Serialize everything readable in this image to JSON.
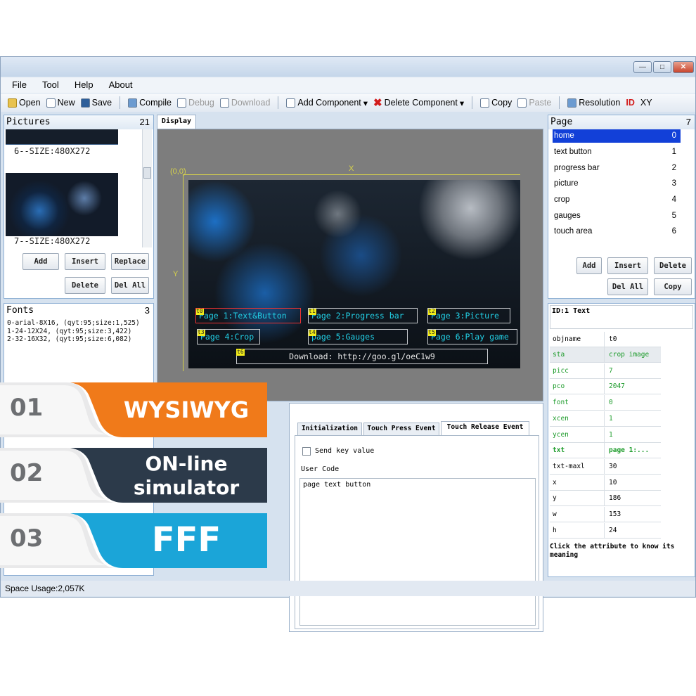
{
  "window": {
    "min_glyph": "—",
    "max_glyph": "□",
    "close_glyph": "✕"
  },
  "menu": [
    "File",
    "Tool",
    "Help",
    "About"
  ],
  "toolbar": {
    "open": "Open",
    "new": "New",
    "save": "Save",
    "compile": "Compile",
    "debug": "Debug",
    "download": "Download",
    "add_component": "Add Component",
    "delete_component": "Delete Component",
    "copy": "Copy",
    "paste": "Paste",
    "resolution": "Resolution",
    "id": "ID",
    "xy": "XY",
    "dropdown": "▾"
  },
  "pictures": {
    "title": "Pictures",
    "count": "21",
    "cap6": "6--SIZE:480X272",
    "cap7": "7--SIZE:480X272",
    "add": "Add",
    "insert": "Insert",
    "replace": "Replace",
    "delete": "Delete",
    "del_all": "Del All"
  },
  "fonts": {
    "title": "Fonts",
    "count": "3",
    "items": [
      "0-arial-8X16, (qyt:95;size:1,525)",
      "1-24-12X24, (qyt:95;size:3,422)",
      "2-32-16X32, (qyt:95;size:6,082)"
    ]
  },
  "display": {
    "tab": "Display",
    "origin": "(0,0)",
    "x_label": "X",
    "y_label": "Y",
    "buttons": [
      {
        "tag": "t0",
        "text": "Page 1:Text&Button"
      },
      {
        "tag": "t1",
        "text": "Page 2:Progress bar"
      },
      {
        "tag": "t2",
        "text": "Page 3:Picture"
      },
      {
        "tag": "t3",
        "text": "Page 4:Crop"
      },
      {
        "tag": "t4",
        "text": "page 5:Gauges"
      },
      {
        "tag": "t5",
        "text": "Page 6:Play game"
      }
    ],
    "download_tag": "t6",
    "download_text": "Download: http://goo.gl/oeC1w9"
  },
  "events": {
    "tabs": [
      "Initialization",
      "Touch Press Event",
      "Touch Release Event"
    ],
    "send_key": "Send key value",
    "user_code_label": "User Code",
    "code": "page text button"
  },
  "page": {
    "title": "Page",
    "count": "7",
    "items": [
      {
        "name": "home",
        "n": "0"
      },
      {
        "name": "text button",
        "n": "1"
      },
      {
        "name": "progress bar",
        "n": "2"
      },
      {
        "name": "picture",
        "n": "3"
      },
      {
        "name": "crop",
        "n": "4"
      },
      {
        "name": "gauges",
        "n": "5"
      },
      {
        "name": "touch area",
        "n": "6"
      }
    ],
    "add": "Add",
    "insert": "Insert",
    "delete": "Delete",
    "del_all": "Del All",
    "copy": "Copy"
  },
  "attrs": {
    "header": "ID:1 Text",
    "rows": [
      {
        "k": "objname",
        "v": "t0"
      },
      {
        "k": "sta",
        "v": "crop image"
      },
      {
        "k": "picc",
        "v": "7"
      },
      {
        "k": "pco",
        "v": "2047"
      },
      {
        "k": "font",
        "v": "0"
      },
      {
        "k": "xcen",
        "v": "1"
      },
      {
        "k": "ycen",
        "v": "1"
      },
      {
        "k": "txt",
        "v": "page 1:..."
      },
      {
        "k": "txt-maxl",
        "v": "30"
      },
      {
        "k": "x",
        "v": "10"
      },
      {
        "k": "y",
        "v": "186"
      },
      {
        "k": "w",
        "v": "153"
      },
      {
        "k": "h",
        "v": "24"
      }
    ],
    "hint": "Click the attribute to know its meaning"
  },
  "status": "Space Usage:2,057K",
  "banners": [
    {
      "num": "01",
      "l1": "WYSIWYG",
      "l2": ""
    },
    {
      "num": "02",
      "l1": "ON-line",
      "l2": "simulator"
    },
    {
      "num": "03",
      "l1": "FFF",
      "l2": ""
    }
  ],
  "colors": {
    "orange": "#f07a1a",
    "navy": "#2c3a4a",
    "blue": "#1ba5d8",
    "selection": "#1240d8"
  }
}
